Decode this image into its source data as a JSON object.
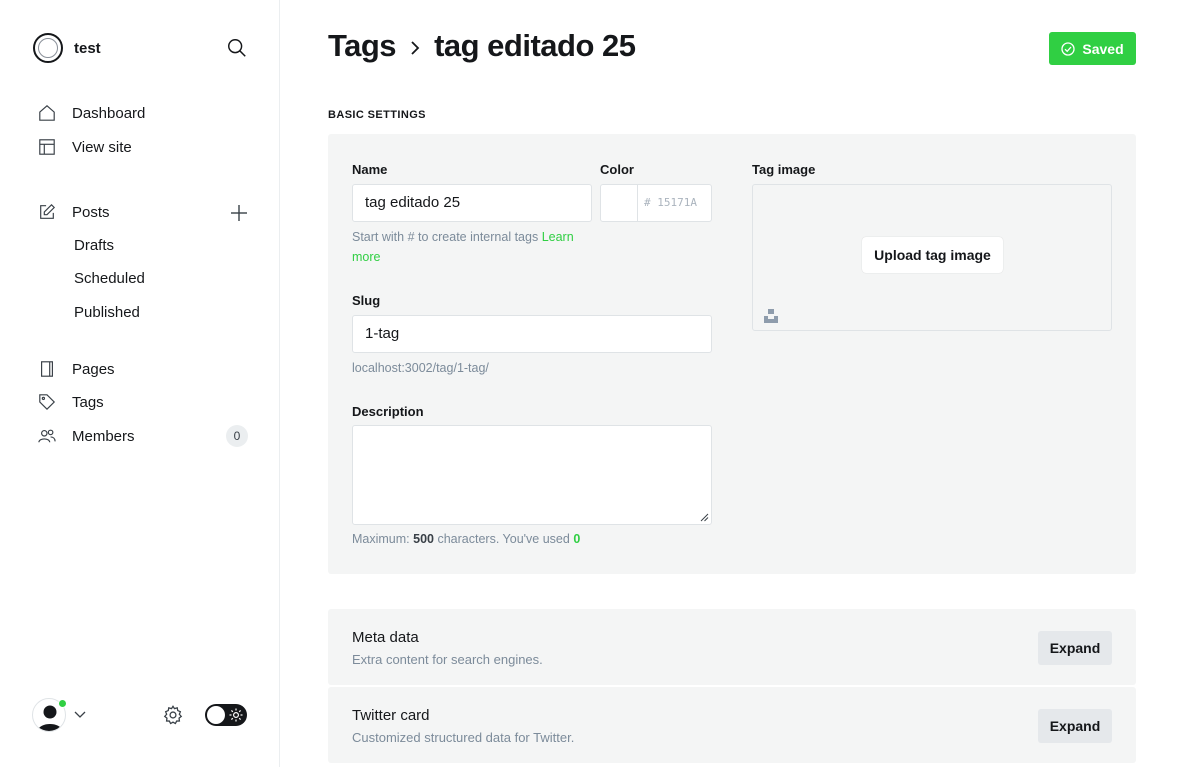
{
  "sidebar": {
    "site_name": "test",
    "nav": [
      {
        "label": "Dashboard",
        "icon": "home-icon"
      },
      {
        "label": "View site",
        "icon": "layout-icon"
      }
    ],
    "posts": {
      "label": "Posts",
      "icon": "edit-icon",
      "sub": [
        "Drafts",
        "Scheduled",
        "Published"
      ]
    },
    "nav2": [
      {
        "label": "Pages",
        "icon": "page-icon"
      },
      {
        "label": "Tags",
        "icon": "tag-icon"
      },
      {
        "label": "Members",
        "icon": "members-icon",
        "count": "0"
      }
    ]
  },
  "header": {
    "breadcrumb_root": "Tags",
    "tag_name": "tag editado 25",
    "saved_label": "Saved"
  },
  "basic_settings": {
    "section_label": "BASIC SETTINGS",
    "name_label": "Name",
    "name_value": "tag editado 25",
    "name_hint": "Start with # to create internal tags",
    "name_hint_link": "Learn more",
    "color_label": "Color",
    "color_placeholder": "# 15171A",
    "slug_label": "Slug",
    "slug_value": "1-tag",
    "slug_url": "localhost:3002/tag/1-tag/",
    "description_label": "Description",
    "description_value": "",
    "desc_hint_prefix": "Maximum:",
    "desc_max": "500",
    "desc_hint_mid": "characters. You've used",
    "desc_used": "0",
    "tag_image_label": "Tag image",
    "upload_label": "Upload tag image"
  },
  "expanders": [
    {
      "title": "Meta data",
      "desc": "Extra content for search engines.",
      "button": "Expand"
    },
    {
      "title": "Twitter card",
      "desc": "Customized structured data for Twitter.",
      "button": "Expand"
    }
  ],
  "colors": {
    "accent": "#30cf43",
    "text": "#15171a",
    "muted": "#7c8b9a",
    "panel": "#f4f5f5"
  }
}
